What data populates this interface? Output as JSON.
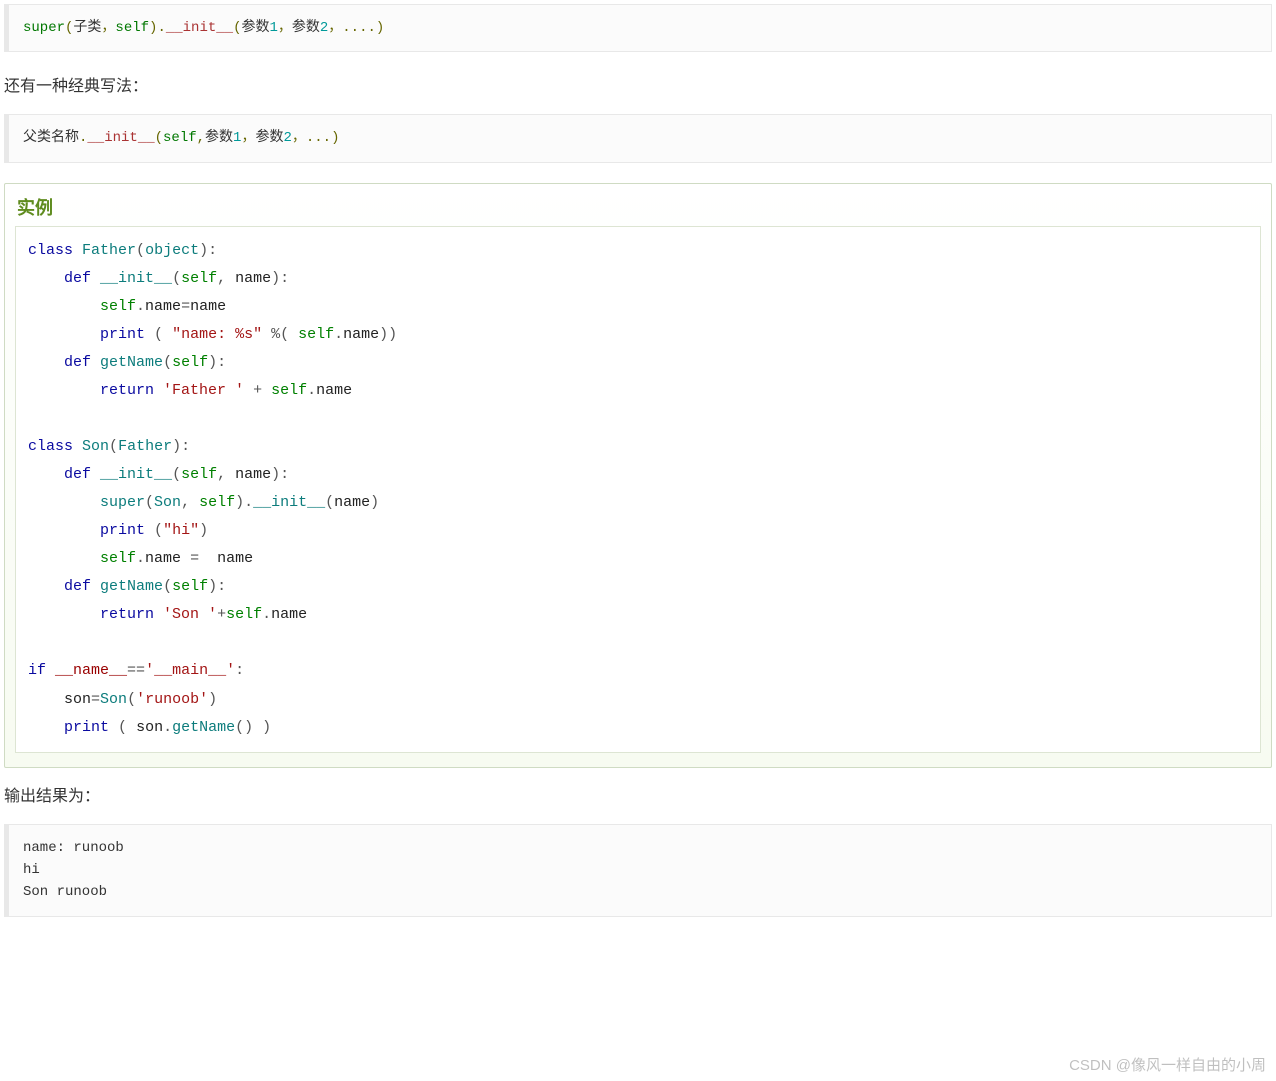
{
  "pre1": {
    "kw1": "super",
    "p_open": "(",
    "arg1": "子类",
    "comma1": "，",
    "arg2": "self",
    "p_close": ")",
    "dot": ".",
    "method": "__init__",
    "p2_open": "(",
    "a1": "参数",
    "n1": "1",
    "c2": "，",
    "a2": "参数",
    "n2": "2",
    "c3": "，",
    "dots": "....",
    "p2_close": ")"
  },
  "para1": "还有一种经典写法：",
  "pre2": {
    "parent": "父类名称",
    "dot": ".",
    "method": "__init__",
    "p_open": "(",
    "selfkw": "self",
    "c1": ",",
    "a1": "参数",
    "n1": "1",
    "c2": "，",
    "a2": "参数",
    "n2": "2",
    "c3": "，",
    "dots": "...",
    "p_close": ")"
  },
  "example": {
    "heading": "实例",
    "lines": [
      [
        {
          "c": "blue",
          "t": "class"
        },
        {
          "c": "black",
          "t": " "
        },
        {
          "c": "teal",
          "t": "Father"
        },
        {
          "c": "punct",
          "t": "("
        },
        {
          "c": "teal",
          "t": "object"
        },
        {
          "c": "punct",
          "t": "):"
        }
      ],
      [
        {
          "c": "black",
          "t": "    "
        },
        {
          "c": "blue",
          "t": "def"
        },
        {
          "c": "black",
          "t": " "
        },
        {
          "c": "teal",
          "t": "__init__"
        },
        {
          "c": "punct",
          "t": "("
        },
        {
          "c": "green2",
          "t": "self"
        },
        {
          "c": "punct",
          "t": ", "
        },
        {
          "c": "black",
          "t": "name"
        },
        {
          "c": "punct",
          "t": "):"
        }
      ],
      [
        {
          "c": "black",
          "t": "        "
        },
        {
          "c": "green2",
          "t": "self"
        },
        {
          "c": "punct",
          "t": "."
        },
        {
          "c": "black",
          "t": "name"
        },
        {
          "c": "punct",
          "t": "="
        },
        {
          "c": "black",
          "t": "name"
        }
      ],
      [
        {
          "c": "black",
          "t": "        "
        },
        {
          "c": "blue",
          "t": "print"
        },
        {
          "c": "black",
          "t": " "
        },
        {
          "c": "punct",
          "t": "( "
        },
        {
          "c": "maroon",
          "t": "\"name: %s\""
        },
        {
          "c": "black",
          "t": " "
        },
        {
          "c": "punct",
          "t": "%( "
        },
        {
          "c": "green2",
          "t": "self"
        },
        {
          "c": "punct",
          "t": "."
        },
        {
          "c": "black",
          "t": "name"
        },
        {
          "c": "punct",
          "t": "))"
        }
      ],
      [
        {
          "c": "black",
          "t": "    "
        },
        {
          "c": "blue",
          "t": "def"
        },
        {
          "c": "black",
          "t": " "
        },
        {
          "c": "teal",
          "t": "getName"
        },
        {
          "c": "punct",
          "t": "("
        },
        {
          "c": "green2",
          "t": "self"
        },
        {
          "c": "punct",
          "t": "):"
        }
      ],
      [
        {
          "c": "black",
          "t": "        "
        },
        {
          "c": "blue",
          "t": "return"
        },
        {
          "c": "black",
          "t": " "
        },
        {
          "c": "maroon",
          "t": "'Father '"
        },
        {
          "c": "black",
          "t": " "
        },
        {
          "c": "punct",
          "t": "+ "
        },
        {
          "c": "green2",
          "t": "self"
        },
        {
          "c": "punct",
          "t": "."
        },
        {
          "c": "black",
          "t": "name"
        }
      ],
      [
        {
          "c": "black",
          "t": " "
        }
      ],
      [
        {
          "c": "blue",
          "t": "class"
        },
        {
          "c": "black",
          "t": " "
        },
        {
          "c": "teal",
          "t": "Son"
        },
        {
          "c": "punct",
          "t": "("
        },
        {
          "c": "teal",
          "t": "Father"
        },
        {
          "c": "punct",
          "t": "):"
        }
      ],
      [
        {
          "c": "black",
          "t": "    "
        },
        {
          "c": "blue",
          "t": "def"
        },
        {
          "c": "black",
          "t": " "
        },
        {
          "c": "teal",
          "t": "__init__"
        },
        {
          "c": "punct",
          "t": "("
        },
        {
          "c": "green2",
          "t": "self"
        },
        {
          "c": "punct",
          "t": ", "
        },
        {
          "c": "black",
          "t": "name"
        },
        {
          "c": "punct",
          "t": "):"
        }
      ],
      [
        {
          "c": "black",
          "t": "        "
        },
        {
          "c": "teal",
          "t": "super"
        },
        {
          "c": "punct",
          "t": "("
        },
        {
          "c": "teal",
          "t": "Son"
        },
        {
          "c": "punct",
          "t": ", "
        },
        {
          "c": "green2",
          "t": "self"
        },
        {
          "c": "punct",
          "t": ")."
        },
        {
          "c": "teal",
          "t": "__init__"
        },
        {
          "c": "punct",
          "t": "("
        },
        {
          "c": "black",
          "t": "name"
        },
        {
          "c": "punct",
          "t": ")"
        }
      ],
      [
        {
          "c": "black",
          "t": "        "
        },
        {
          "c": "blue",
          "t": "print"
        },
        {
          "c": "black",
          "t": " "
        },
        {
          "c": "punct",
          "t": "("
        },
        {
          "c": "maroon",
          "t": "\"hi\""
        },
        {
          "c": "punct",
          "t": ")"
        }
      ],
      [
        {
          "c": "black",
          "t": "        "
        },
        {
          "c": "green2",
          "t": "self"
        },
        {
          "c": "punct",
          "t": "."
        },
        {
          "c": "black",
          "t": "name"
        },
        {
          "c": "black",
          "t": " "
        },
        {
          "c": "punct",
          "t": "="
        },
        {
          "c": "black",
          "t": "  name"
        }
      ],
      [
        {
          "c": "black",
          "t": "    "
        },
        {
          "c": "blue",
          "t": "def"
        },
        {
          "c": "black",
          "t": " "
        },
        {
          "c": "teal",
          "t": "getName"
        },
        {
          "c": "punct",
          "t": "("
        },
        {
          "c": "green2",
          "t": "self"
        },
        {
          "c": "punct",
          "t": "):"
        }
      ],
      [
        {
          "c": "black",
          "t": "        "
        },
        {
          "c": "blue",
          "t": "return"
        },
        {
          "c": "black",
          "t": " "
        },
        {
          "c": "maroon",
          "t": "'Son '"
        },
        {
          "c": "punct",
          "t": "+"
        },
        {
          "c": "green2",
          "t": "self"
        },
        {
          "c": "punct",
          "t": "."
        },
        {
          "c": "black",
          "t": "name"
        }
      ],
      [
        {
          "c": "black",
          "t": " "
        }
      ],
      [
        {
          "c": "blue",
          "t": "if"
        },
        {
          "c": "black",
          "t": " "
        },
        {
          "c": "darkred",
          "t": "__name__"
        },
        {
          "c": "punct",
          "t": "=="
        },
        {
          "c": "maroon",
          "t": "'__main__'"
        },
        {
          "c": "punct",
          "t": ":"
        }
      ],
      [
        {
          "c": "black",
          "t": "    "
        },
        {
          "c": "black",
          "t": "son"
        },
        {
          "c": "punct",
          "t": "="
        },
        {
          "c": "teal",
          "t": "Son"
        },
        {
          "c": "punct",
          "t": "("
        },
        {
          "c": "maroon",
          "t": "'runoob'"
        },
        {
          "c": "punct",
          "t": ")"
        }
      ],
      [
        {
          "c": "black",
          "t": "    "
        },
        {
          "c": "blue",
          "t": "print"
        },
        {
          "c": "black",
          "t": " "
        },
        {
          "c": "punct",
          "t": "( "
        },
        {
          "c": "black",
          "t": "son"
        },
        {
          "c": "punct",
          "t": "."
        },
        {
          "c": "teal",
          "t": "getName"
        },
        {
          "c": "punct",
          "t": "() )"
        }
      ]
    ]
  },
  "para2": "输出结果为：",
  "output": "name: runoob\nhi\nSon runoob",
  "watermark": "CSDN @像风一样自由的小周"
}
